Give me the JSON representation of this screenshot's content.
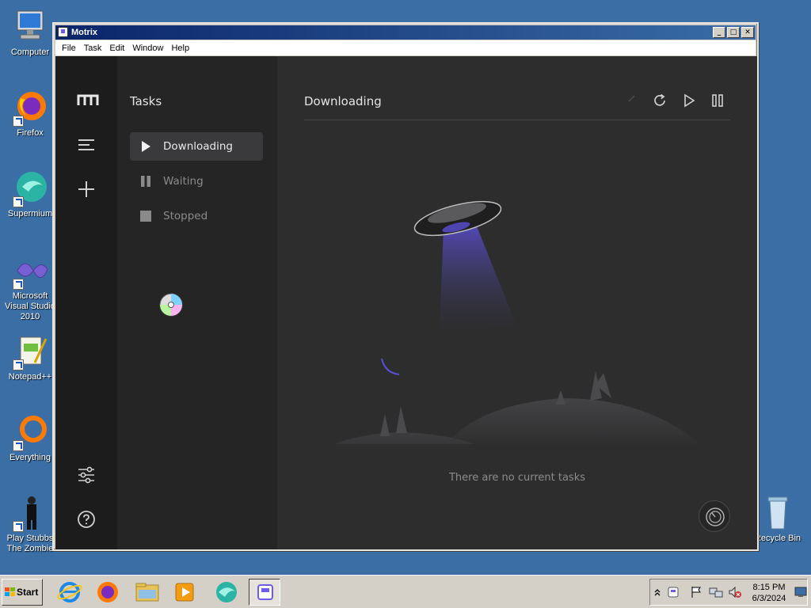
{
  "desktop": {
    "icons": [
      {
        "label": "Computer"
      },
      {
        "label": "Firefox"
      },
      {
        "label": "Supermium"
      },
      {
        "label": "Microsoft Visual Studio 2010"
      },
      {
        "label": "Notepad++"
      },
      {
        "label": "Everything"
      },
      {
        "label": "Play Stubbs The Zombie"
      },
      {
        "label": "Recycle Bin"
      }
    ]
  },
  "window": {
    "title": "Motrix",
    "controls": [
      "_",
      "□",
      "✕"
    ],
    "menu": [
      "File",
      "Task",
      "Edit",
      "Window",
      "Help"
    ]
  },
  "app": {
    "rail": {
      "logo_icon": "motrix-logo-icon",
      "items": [
        "menu-icon",
        "add-task-icon"
      ],
      "bottom": [
        "preferences-icon",
        "help-icon"
      ]
    },
    "sidebar": {
      "title": "Tasks",
      "items": [
        {
          "label": "Downloading",
          "icon": "play-icon",
          "active": true
        },
        {
          "label": "Waiting",
          "icon": "pause-icon",
          "active": false
        },
        {
          "label": "Stopped",
          "icon": "stop-icon",
          "active": false
        }
      ]
    },
    "main": {
      "title": "Downloading",
      "toolbar": [
        "delete-icon",
        "refresh-icon",
        "resume-all-icon",
        "pause-all-icon"
      ],
      "empty_text": "There are no current tasks"
    }
  },
  "taskbar": {
    "start_label": "Start",
    "apps": [
      "internet-explorer",
      "firefox",
      "file-explorer",
      "media-player",
      "supermium",
      "motrix"
    ],
    "clock": {
      "time": "8:15 PM",
      "date": "6/3/2024"
    }
  },
  "colors": {
    "desktop": "#3a6ea5",
    "app_bg": "#2d2d2e",
    "sidebar_bg": "#252526",
    "rail_bg": "#1c1c1d",
    "accent": "#5b4fd6"
  }
}
